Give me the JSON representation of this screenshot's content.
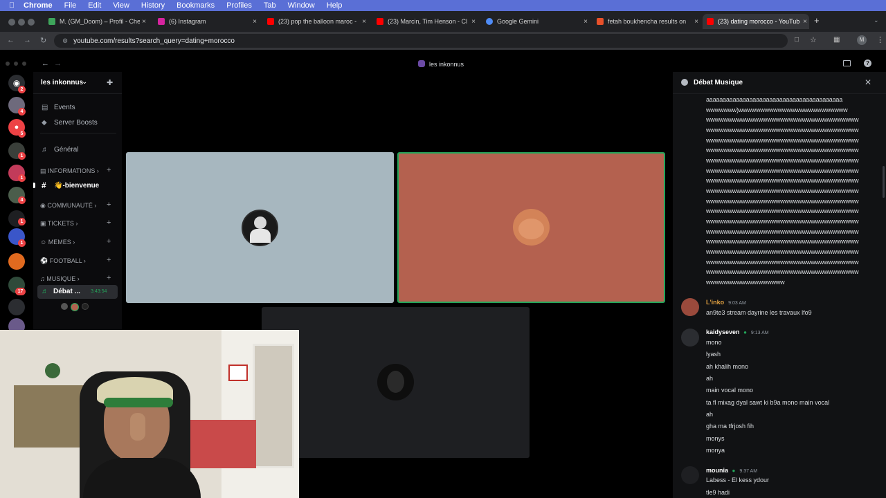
{
  "menubar": {
    "items": [
      "Chrome",
      "File",
      "Edit",
      "View",
      "History",
      "Bookmarks",
      "Profiles",
      "Tab",
      "Window",
      "Help"
    ]
  },
  "browser": {
    "tabs": [
      {
        "title": "M. (GM_Doom) – Profil - Che",
        "icon_color": "#3ea55b"
      },
      {
        "title": "(6) Instagram",
        "icon_color": "#d6249f"
      },
      {
        "title": "(23) pop the balloon maroc -",
        "icon_color": "#ff0000"
      },
      {
        "title": "(23) Marcin, Tim Henson - Cl",
        "icon_color": "#ff0000"
      },
      {
        "title": "Google Gemini",
        "icon_color": "#4f8cf7"
      },
      {
        "title": "fetah boukhencha results on",
        "icon_color": "#e8512a"
      },
      {
        "title": "(23) dating morocco - YouTub",
        "icon_color": "#ff0000"
      }
    ],
    "new_tab": "+",
    "url": "youtube.com/results?search_query=dating+morocco"
  },
  "discord": {
    "window_title": "les inkonnus",
    "server_name": "les inkonnus",
    "guild_badges": [
      "2",
      "4",
      "5",
      "1",
      "1",
      "4",
      "1",
      "1",
      "17"
    ],
    "channels": {
      "events": "Events",
      "server_boosts": "Server Boosts",
      "general": "Général",
      "cat_informations": "INFORMATIONS",
      "bienvenue": "👋-bienvenue",
      "cat_communaute": "COMMUNAUTÉ",
      "cat_tickets": "TICKETS",
      "cat_memes": "MEMES",
      "cat_football": "FOOTBALL",
      "cat_musique": "MUSIQUE",
      "voice_channel": "Débat ...",
      "voice_timer": "3:43:54"
    },
    "chat": {
      "title": "Débat Musique",
      "spam_lines": [
        "aaaaaaaaaaaaaaaaaaaaaaaaaaaaaaaaaaaaaaaaa",
        "wwwwwww)wwwwwwwwwwwwwwwwwwwwwwwww",
        "wwwwwwwwwwwwwwwwwwwwwwwwwwwwwwwwwww",
        "wwwwwwwwwwwwwwwwwwwwwwwwwwwwwwwwwww",
        "wwwwwwwwwwwwwwwwwwwwwwwwwwwwwwwwwww",
        "wwwwwwwwwwwwwwwwwwwwwwwwwwwwwwwwwww",
        "wwwwwwwwwwwwwwwwwwwwwwwwwwwwwwwwwww",
        "wwwwwwwwwwwwwwwwwwwwwwwwwwwwwwwwwww",
        "wwwwwwwwwwwwwwwwwwwwwwwwwwwwwwwwwww",
        "wwwwwwwwwwwwwwwwwwwwwwwwwwwwwwwwwww",
        "wwwwwwwwwwwwwwwwwwwwwwwwwwwwwwwwwww",
        "wwwwwwwwwwwwwwwwwwwwwwwwwwwwwwwwwww",
        "wwwwwwwwwwwwwwwwwwwwwwwwwwwwwwwwwww",
        "wwwwwwwwwwwwwwwwwwwwwwwwwwwwwwwwwww",
        "wwwwwwwwwwwwwwwwwwwwwwwwwwwwwwwwwww",
        "wwwwwwwwwwwwwwwwwwwwwwwwwwwwwwwwwww",
        "wwwwwwwwwwwwwwwwwwwwwwwwwwwwwwwwwww",
        "wwwwwwwwwwwwwwwwwwwwwwwwwwwwwwwwwww",
        "wwwwwwwwwwwwwwwwww"
      ],
      "messages": [
        {
          "author": "L'inko",
          "author_color": "#e0a040",
          "time": "9:03 AM",
          "lines": [
            "an9te3 stream dayrine les travaux lfo9"
          ]
        },
        {
          "author": "kaidyseven",
          "author_color": "#ffffff",
          "time": "9:13 AM",
          "lines": [
            "mono",
            "lyash",
            "ah khalih mono",
            "ah",
            "main vocal mono",
            "ta fl mixag dyal sawt ki b9a mono main vocal",
            "ah",
            "gha ma tfrjosh fih",
            "monys",
            "monya"
          ]
        },
        {
          "author": "mounia",
          "author_color": "#ffffff",
          "time": "9:37 AM",
          "lines": [
            "Labess - El kess ydour",
            "tle9 hadi"
          ]
        }
      ]
    }
  }
}
